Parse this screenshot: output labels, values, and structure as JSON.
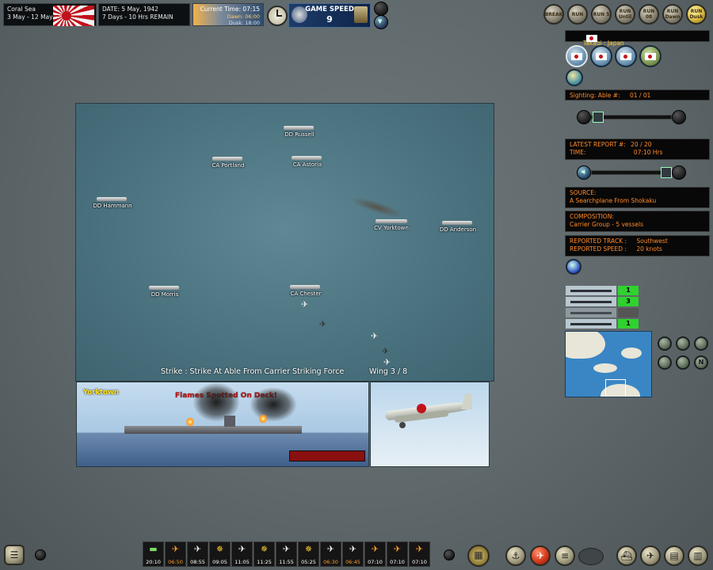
{
  "top": {
    "scenario_name": "Coral Sea",
    "scenario_dates": "3 May - 12 May, 1942",
    "date_line": "DATE: 5 May, 1942",
    "remaining_line": "7 Days - 10 Hrs REMAIN",
    "current_time": "Current Time: 07:15",
    "dawn": "Dawn: 06:00",
    "dusk": "Dusk: 18:00",
    "game_speed_label": "GAME SPEED",
    "game_speed_value": "9",
    "run_buttons": [
      {
        "name": "break-button",
        "label": "BREAK"
      },
      {
        "name": "run-button",
        "label": "RUN"
      },
      {
        "name": "run-5-button",
        "label": "RUN 5"
      },
      {
        "name": "run-until-button",
        "label": "RUN Until"
      },
      {
        "name": "run-08-button",
        "label": "RUN 08"
      },
      {
        "name": "run-dawn-button",
        "label": "RUN Dawn"
      },
      {
        "name": "run-dusk-button",
        "label": "RUN Dusk"
      }
    ]
  },
  "right_panel": {
    "commander": "Takagi : Japan",
    "sighting_label": "Sighting: Able #:",
    "sighting_value": "01 / 01",
    "latest_report_label": "LATEST REPORT  #:",
    "latest_report_value": "20 / 20",
    "time_label": "TIME:",
    "time_value": "07:10 Hrs",
    "source_label": "SOURCE:",
    "source_value": "A Searchplane From Shokaku",
    "composition_label": "COMPOSITION:",
    "composition_value": "Carrier Group - 5 vessels",
    "track_label": "REPORTED TRACK :",
    "track_value": "Southwest",
    "speed_label": "REPORTED SPEED :",
    "speed_value": "20 knots",
    "roster": [
      {
        "count": "1"
      },
      {
        "count": "3"
      },
      {
        "count": ""
      },
      {
        "count": "1"
      }
    ],
    "map_buttons": [
      "",
      "",
      "",
      "",
      "",
      "N"
    ]
  },
  "map": {
    "ships": [
      {
        "name": "DD Russell"
      },
      {
        "name": "CA Portland"
      },
      {
        "name": "CA Astoria"
      },
      {
        "name": "DD Hammann"
      },
      {
        "name": "CV Yorktown"
      },
      {
        "name": "DD Anderson"
      },
      {
        "name": "DD Morris"
      },
      {
        "name": "CA Chester"
      }
    ],
    "strike_text": "Strike : Strike At Able From Carrier Striking Force",
    "wing_text": "Wing 3 / 8"
  },
  "damage_panel": {
    "ship_name": "Yorktown",
    "message": "Flames Spotted On Deck!",
    "damage_fraction": 1.0
  },
  "timeline": [
    {
      "icon": "recon",
      "time": "20:10",
      "hot": false
    },
    {
      "icon": "strike",
      "time": "06:50",
      "hot": true
    },
    {
      "icon": "plane",
      "time": "08:55",
      "hot": false
    },
    {
      "icon": "cap",
      "time": "09:05",
      "hot": false
    },
    {
      "icon": "plane",
      "time": "11:05",
      "hot": false
    },
    {
      "icon": "cap",
      "time": "11:25",
      "hot": false
    },
    {
      "icon": "plane",
      "time": "11:55",
      "hot": false
    },
    {
      "icon": "cap",
      "time": "05:25",
      "hot": false
    },
    {
      "icon": "plane",
      "time": "06:30",
      "hot": true
    },
    {
      "icon": "plane",
      "time": "06:45",
      "hot": true
    },
    {
      "icon": "strike",
      "time": "07:10",
      "hot": false
    },
    {
      "icon": "strike",
      "time": "07:10",
      "hot": false
    },
    {
      "icon": "strike",
      "time": "07:10",
      "hot": false
    }
  ],
  "colors": {
    "report_orange": "#ff8a2a",
    "count_green": "#2fd22f",
    "japan_red": "#c1121b"
  }
}
